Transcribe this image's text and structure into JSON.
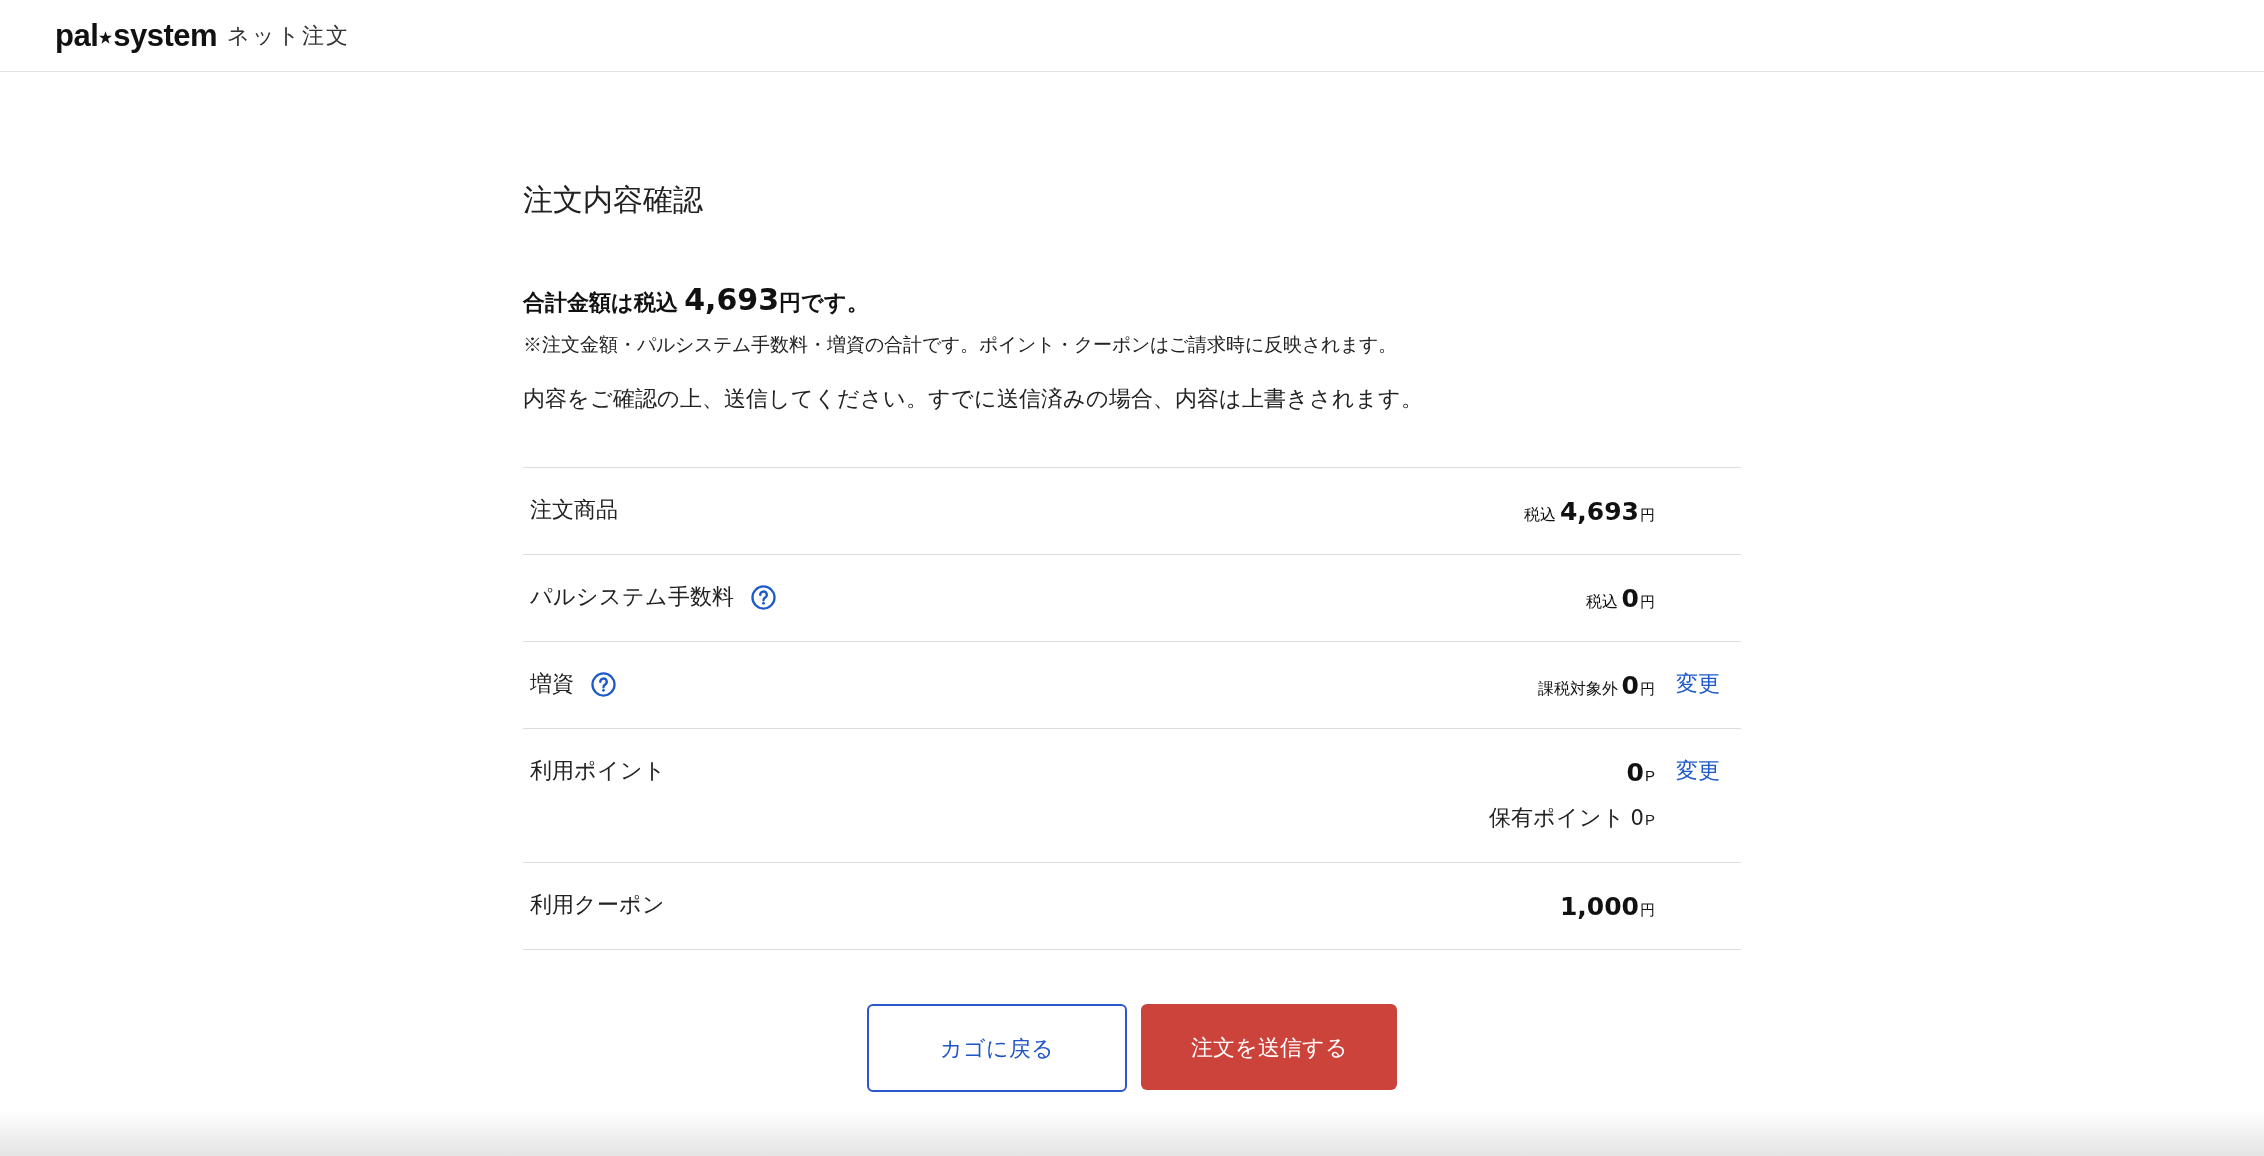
{
  "header": {
    "logo_words": [
      "pal",
      "system"
    ],
    "service_name": "ネット注文"
  },
  "title": "注文内容確認",
  "total": {
    "prefix": "合計金額は税込",
    "amount": "4,693",
    "suffix": "円です。"
  },
  "note": "※注文金額・パルシステム手数料・増資の合計です。ポイント・クーポンはご請求時に反映されます。",
  "instruction": "内容をご確認の上、送信してください。すでに送信済みの場合、内容は上書きされます。",
  "rows": [
    {
      "label": "注文商品",
      "help": false,
      "amount": {
        "prefix": "税込",
        "value": "4,693",
        "unit": "円"
      }
    },
    {
      "label": "パルシステム手数料",
      "help": true,
      "amount": {
        "prefix": "税込",
        "value": "0",
        "unit": "円"
      }
    },
    {
      "label": "増資",
      "help": true,
      "amount": {
        "prefix": "課税対象外",
        "value": "0",
        "unit": "円"
      },
      "action": "変更"
    },
    {
      "label": "利用ポイント",
      "help": false,
      "amount": {
        "value": "0",
        "unit": "P"
      },
      "action": "変更",
      "balance": {
        "label": "保有ポイント",
        "value": "0",
        "unit": "P"
      }
    },
    {
      "label": "利用クーポン",
      "help": false,
      "amount": {
        "value": "1,000",
        "unit": "円"
      }
    }
  ],
  "buttons": [
    {
      "kind": "secondary",
      "label": "カゴに戻る"
    },
    {
      "kind": "primary",
      "label": "注文を送信する"
    }
  ]
}
